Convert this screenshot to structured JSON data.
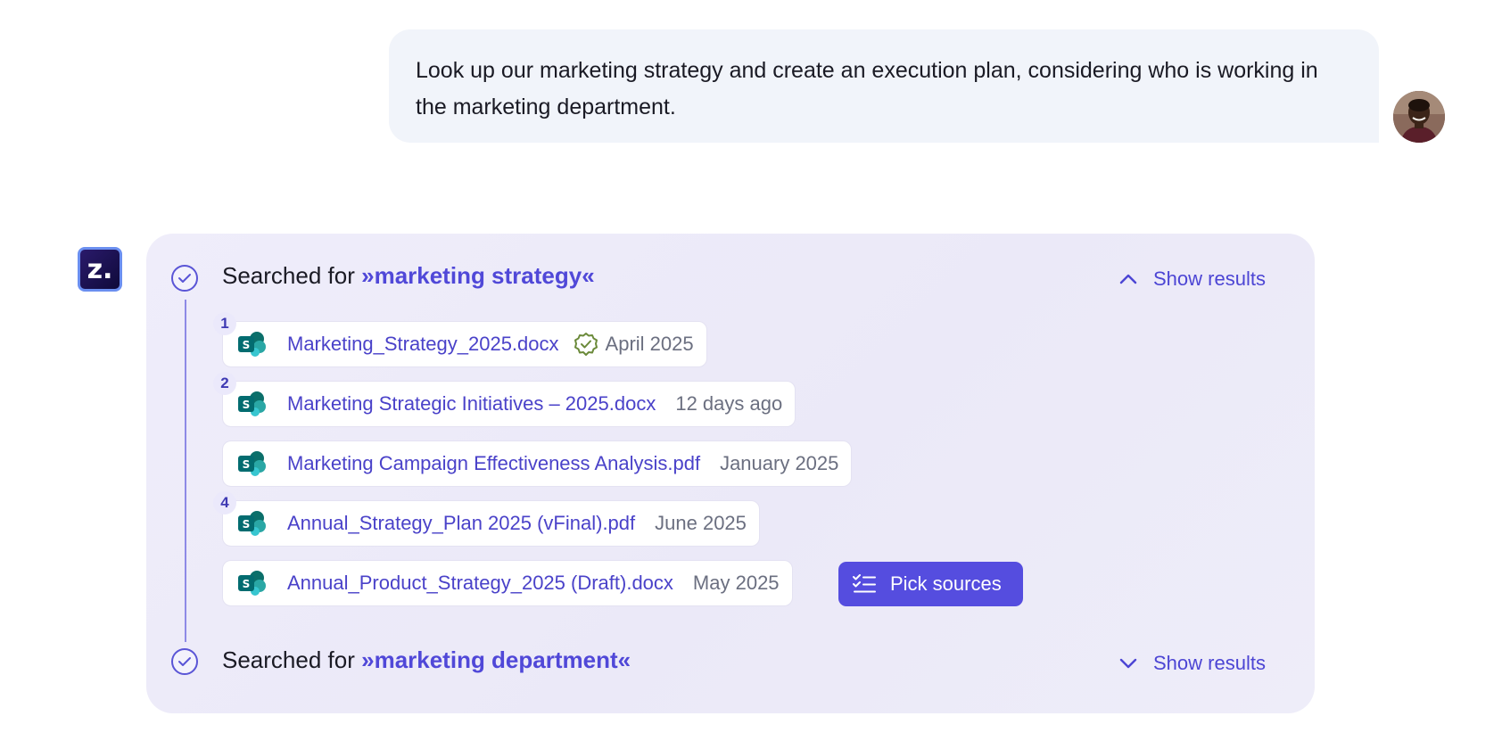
{
  "user_message": {
    "text": "Look up our marketing strategy and create an execution plan, considering who is working in the marketing department."
  },
  "assistant": {
    "logo_text": "z.",
    "searches": [
      {
        "prefix": "Searched for",
        "query": "»marketing strategy«",
        "toggle_label": "Show results",
        "expanded": true,
        "results": [
          {
            "index": "1",
            "name": "Marketing_Strategy_2025.docx",
            "verified": true,
            "date": "April 2025",
            "source_icon": "sharepoint-icon"
          },
          {
            "index": "2",
            "name": "Marketing Strategic Initiatives – 2025.docx",
            "verified": false,
            "date": "12 days ago",
            "source_icon": "sharepoint-icon"
          },
          {
            "index": "",
            "name": "Marketing Campaign Effectiveness Analysis.pdf",
            "verified": false,
            "date": "January 2025",
            "source_icon": "sharepoint-icon"
          },
          {
            "index": "4",
            "name": "Annual_Strategy_Plan 2025 (vFinal).pdf",
            "verified": false,
            "date": "June 2025",
            "source_icon": "sharepoint-icon"
          },
          {
            "index": "",
            "name": "Annual_Product_Strategy_2025 (Draft).docx",
            "verified": false,
            "date": "May 2025",
            "source_icon": "sharepoint-icon"
          }
        ],
        "pick_sources_label": "Pick sources"
      },
      {
        "prefix": "Searched for",
        "query": "»marketing department«",
        "toggle_label": "Show results",
        "expanded": false
      }
    ]
  },
  "colors": {
    "accent": "#554ddf",
    "link": "#4a42c9",
    "panel_bg": "#edebf9",
    "user_bubble_bg": "#f1f4fa",
    "verified_green": "#6b8a3a"
  }
}
